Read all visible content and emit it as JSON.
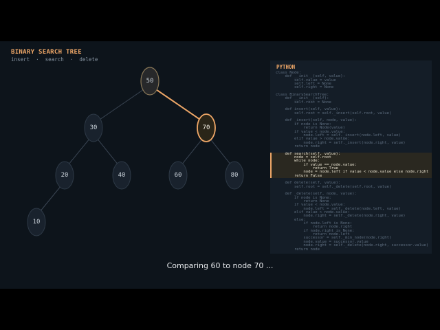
{
  "header": {
    "title": "BINARY SEARCH TREE",
    "subtitle": "insert  ·  search  ·  delete"
  },
  "tree": {
    "nodes": [
      {
        "id": "n50",
        "label": "50",
        "state": "visited"
      },
      {
        "id": "n30",
        "label": "30",
        "state": "normal"
      },
      {
        "id": "n70",
        "label": "70",
        "state": "current"
      },
      {
        "id": "n20",
        "label": "20",
        "state": "normal"
      },
      {
        "id": "n40",
        "label": "40",
        "state": "normal"
      },
      {
        "id": "n60",
        "label": "60",
        "state": "normal"
      },
      {
        "id": "n80",
        "label": "80",
        "state": "normal"
      },
      {
        "id": "n10",
        "label": "10",
        "state": "normal"
      }
    ],
    "edges": [
      {
        "from": "n50",
        "to": "n30",
        "active": false
      },
      {
        "from": "n50",
        "to": "n70",
        "active": true
      },
      {
        "from": "n30",
        "to": "n20",
        "active": false
      },
      {
        "from": "n30",
        "to": "n40",
        "active": false
      },
      {
        "from": "n70",
        "to": "n60",
        "active": false
      },
      {
        "from": "n70",
        "to": "n80",
        "active": false
      },
      {
        "from": "n20",
        "to": "n10",
        "active": false
      }
    ]
  },
  "code": {
    "language": "PYTHON",
    "lines": [
      "class Node:",
      "    def __init__(self, value):",
      "        self.value = value",
      "        self.left = None",
      "        self.right = None",
      "",
      "class BinarySearchTree:",
      "    def __init__(self):",
      "        self.root = None",
      "",
      "    def insert(self, value):",
      "        self.root = self._insert(self.root, value)",
      "",
      "    def _insert(self, node, value):",
      "        if node is None:",
      "            return Node(value)",
      "        if value < node.value:",
      "            node.left = self._insert(node.left, value)",
      "        elif value > node.value:",
      "            node.right = self._insert(node.right, value)",
      "        return node",
      "",
      "    def search(self, value):",
      "        node = self.root",
      "        while node:",
      "            if value == node.value:",
      "                return True",
      "            node = node.left if value < node.value else node.right",
      "        return False",
      "",
      "    def delete(self, value):",
      "        self.root = self._delete(self.root, value)",
      "",
      "    def _delete(self, node, value):",
      "        if node is None:",
      "            return None",
      "        if value < node.value:",
      "            node.left = self._delete(node.left, value)",
      "        elif value > node.value:",
      "            node.right = self._delete(node.right, value)",
      "        else:",
      "            if node.left is None:",
      "                return node.right",
      "            if node.right is None:",
      "                return node.left",
      "            successor = self._min_node(node.right)",
      "            node.value = successor.value",
      "            node.right = self._delete(node.right, successor.value)",
      "        return node"
    ],
    "highlighted_lines": [
      22,
      23,
      24,
      25,
      26,
      27,
      28
    ]
  },
  "status": {
    "caption": "Comparing 60 to node 70 ..."
  },
  "colors": {
    "accent": "#f0a868",
    "node_fill": "#19222d",
    "node_stroke": "#2e3a47",
    "node_text": "#c9d1d9",
    "edge": "#3a4553",
    "visited_fill": "#27282a",
    "visited_stroke": "#8a7858",
    "current_fill": "#2a2518"
  }
}
